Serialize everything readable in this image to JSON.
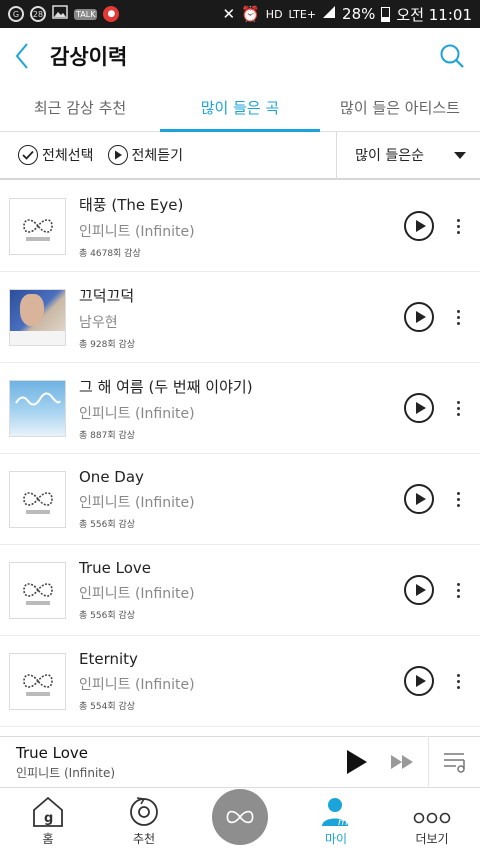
{
  "status_bar": {
    "notif_count": "28",
    "talk_badge": "TALK",
    "hd": "HD",
    "network": "LTE+",
    "battery": "28%",
    "time": "오전 11:01"
  },
  "header": {
    "title": "감상이력"
  },
  "tabs": [
    {
      "label": "최근 감상 추천"
    },
    {
      "label": "많이 들은 곡"
    },
    {
      "label": "많이 들은 아티스트"
    }
  ],
  "toolbar": {
    "select_all": "전체선택",
    "play_all": "전체듣기",
    "sort": "많이 들은순"
  },
  "songs": [
    {
      "title": "태풍 (The Eye)",
      "artist": "인피니트 (Infinite)",
      "plays": "총 4678회 감상"
    },
    {
      "title": "끄덕끄덕",
      "artist": "남우현",
      "plays": "총 928회 감상"
    },
    {
      "title": "그 해 여름 (두 번째 이야기)",
      "artist": "인피니트 (Infinite)",
      "plays": "총 887회 감상"
    },
    {
      "title": "One Day",
      "artist": "인피니트 (Infinite)",
      "plays": "총 556회 감상"
    },
    {
      "title": "True Love",
      "artist": "인피니트 (Infinite)",
      "plays": "총 556회 감상"
    },
    {
      "title": "Eternity",
      "artist": "인피니트 (Infinite)",
      "plays": "총 554회 감상"
    }
  ],
  "mini_player": {
    "title": "True Love",
    "artist": "인피니트 (Infinite)"
  },
  "bottom_nav": [
    {
      "label": "홈",
      "icon": "home-icon"
    },
    {
      "label": "추천",
      "icon": "recommend-icon"
    },
    {
      "label": "",
      "icon": "now-playing-disc"
    },
    {
      "label": "마이",
      "icon": "my-icon"
    },
    {
      "label": "더보기",
      "icon": "more-icon"
    }
  ],
  "colors": {
    "accent": "#1ba4d9",
    "statusbar": "#1a1a1a"
  }
}
